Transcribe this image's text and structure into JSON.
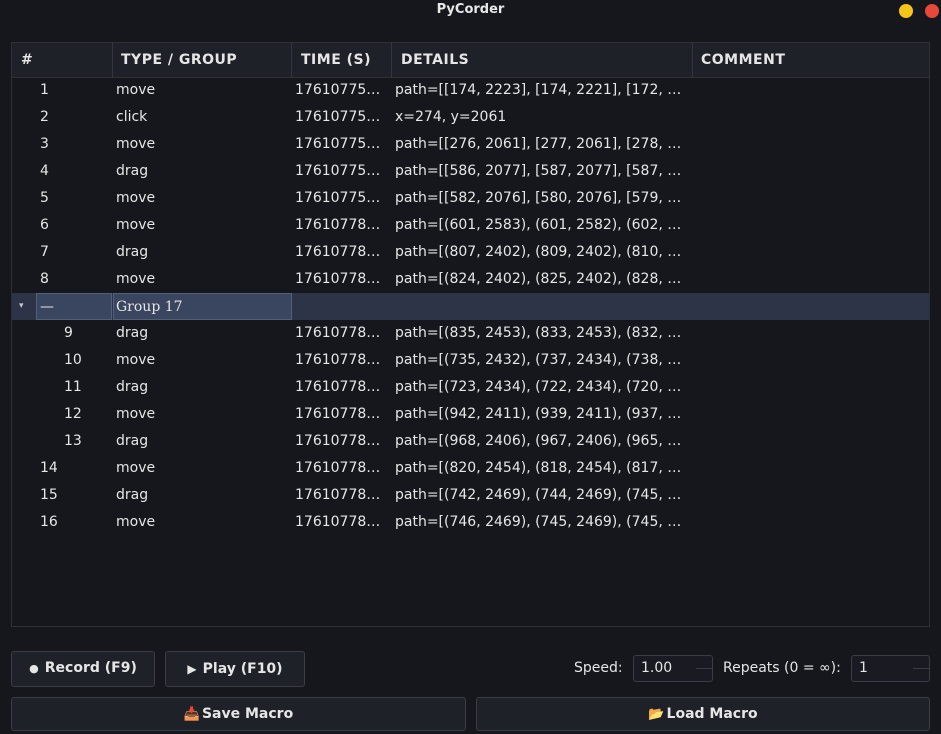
{
  "window": {
    "title": "PyCorder"
  },
  "table": {
    "headers": {
      "num": "#",
      "type": "TYPE / GROUP",
      "time": "TIME (S)",
      "details": "DETAILS",
      "comment": "COMMENT"
    },
    "rows_top": [
      {
        "num": "1",
        "type": "move",
        "time": "17610775…",
        "details": "path=[[174, 2223], [174, 2221], [172, …",
        "comment": ""
      },
      {
        "num": "2",
        "type": "click",
        "time": "17610775…",
        "details": "x=274, y=2061",
        "comment": ""
      },
      {
        "num": "3",
        "type": "move",
        "time": "17610775…",
        "details": "path=[[276, 2061], [277, 2061], [278, …",
        "comment": ""
      },
      {
        "num": "4",
        "type": "drag",
        "time": "17610775…",
        "details": "path=[[586, 2077], [587, 2077], [587, …",
        "comment": ""
      },
      {
        "num": "5",
        "type": "move",
        "time": "17610775…",
        "details": "path=[[582, 2076], [580, 2076], [579, …",
        "comment": ""
      },
      {
        "num": "6",
        "type": "move",
        "time": "17610778…",
        "details": "path=[(601, 2583), (601, 2582), (602, …",
        "comment": ""
      },
      {
        "num": "7",
        "type": "drag",
        "time": "17610778…",
        "details": "path=[(807, 2402), (809, 2402), (810, …",
        "comment": ""
      },
      {
        "num": "8",
        "type": "move",
        "time": "17610778…",
        "details": "path=[(824, 2402), (825, 2402), (828, …",
        "comment": ""
      }
    ],
    "group": {
      "toggle": "—",
      "name": "Group 17",
      "arrow": "▾"
    },
    "rows_group": [
      {
        "num": "9",
        "type": "drag",
        "time": "17610778…",
        "details": "path=[(835, 2453), (833, 2453), (832, …",
        "comment": ""
      },
      {
        "num": "10",
        "type": "move",
        "time": "17610778…",
        "details": "path=[(735, 2432), (737, 2434), (738, …",
        "comment": ""
      },
      {
        "num": "11",
        "type": "drag",
        "time": "17610778…",
        "details": "path=[(723, 2434), (722, 2434), (720, …",
        "comment": ""
      },
      {
        "num": "12",
        "type": "move",
        "time": "17610778…",
        "details": "path=[(942, 2411), (939, 2411), (937, …",
        "comment": ""
      },
      {
        "num": "13",
        "type": "drag",
        "time": "17610778…",
        "details": "path=[(968, 2406), (967, 2406), (965, …",
        "comment": ""
      }
    ],
    "rows_bottom": [
      {
        "num": "14",
        "type": "move",
        "time": "17610778…",
        "details": "path=[(820, 2454), (818, 2454), (817, …",
        "comment": ""
      },
      {
        "num": "15",
        "type": "drag",
        "time": "17610778…",
        "details": "path=[(742, 2469), (744, 2469), (745, …",
        "comment": ""
      },
      {
        "num": "16",
        "type": "move",
        "time": "17610778…",
        "details": "path=[(746, 2469), (745, 2469), (745, …",
        "comment": ""
      }
    ]
  },
  "controls": {
    "record": {
      "icon": "●",
      "label": "Record (F9)"
    },
    "play": {
      "icon": "▶",
      "label": "Play (F10)"
    },
    "speed_label": "Speed:",
    "speed_value": "1.00",
    "repeats_label": "Repeats (0 = ∞):",
    "repeats_value": "1",
    "save": {
      "icon": "📥",
      "label": "Save Macro"
    },
    "load": {
      "icon": "📂",
      "label": "Load Macro"
    }
  },
  "colors": {
    "background": "#16171d",
    "selected_row": "#2d3447",
    "minimize": "#f5c518",
    "close": "#e8483a"
  }
}
